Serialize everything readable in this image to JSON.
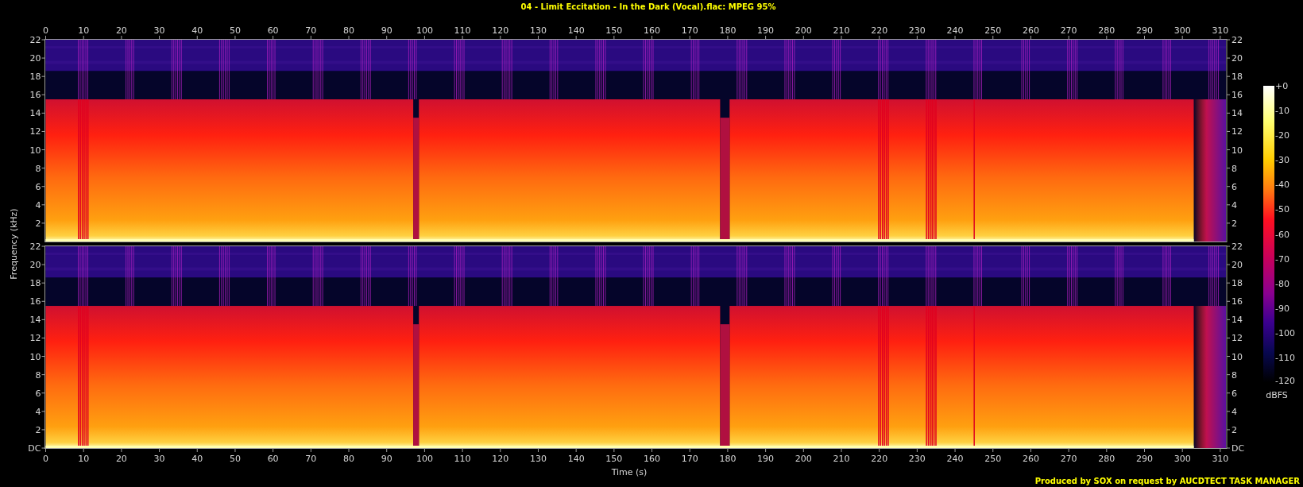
{
  "title": "04 - Limit Eccitation - In the Dark (Vocal).flac: MPEG 95%",
  "time_axis": {
    "label": "Time (s)",
    "top_ticks": [
      "0",
      "10",
      "20",
      "30",
      "40",
      "50",
      "60",
      "70",
      "80",
      "90",
      "100",
      "110",
      "120",
      "130",
      "140",
      "150",
      "160",
      "170",
      "180",
      "190",
      "200",
      "210",
      "220",
      "230",
      "240",
      "250",
      "260",
      "270",
      "280",
      "290",
      "300",
      "310"
    ],
    "bottom_ticks": [
      "0",
      "10",
      "20",
      "30",
      "40",
      "50",
      "60",
      "70",
      "80",
      "90",
      "100",
      "110",
      "120",
      "130",
      "140",
      "150",
      "160",
      "170",
      "180",
      "190",
      "200",
      "210",
      "220",
      "230",
      "240",
      "250",
      "260",
      "270",
      "280",
      "290",
      "300",
      "310"
    ]
  },
  "frequency_axis": {
    "label": "Frequency (kHz)"
  },
  "channels": [
    {
      "left_ticks": [
        "22",
        "20",
        "18",
        "16",
        "14",
        "12",
        "10",
        "8",
        "6",
        "4",
        "2"
      ],
      "right_ticks": [
        "22",
        "20",
        "18",
        "16",
        "14",
        "12",
        "10",
        "8",
        "6",
        "4",
        "2"
      ]
    },
    {
      "left_ticks": [
        "22",
        "20",
        "18",
        "16",
        "14",
        "12",
        "10",
        "8",
        "6",
        "4",
        "2",
        "DC"
      ],
      "right_ticks": [
        "22",
        "20",
        "18",
        "16",
        "14",
        "12",
        "10",
        "8",
        "6",
        "4",
        "2",
        "DC"
      ]
    }
  ],
  "colorbar": {
    "labels": [
      "+0",
      "-10",
      "-20",
      "-30",
      "-40",
      "-50",
      "-60",
      "-70",
      "-80",
      "-90",
      "-100",
      "-110",
      "-120"
    ],
    "unit": "dBFS"
  },
  "footer": "Produced by SOX on request by AUCDTECT TASK MANAGER"
}
